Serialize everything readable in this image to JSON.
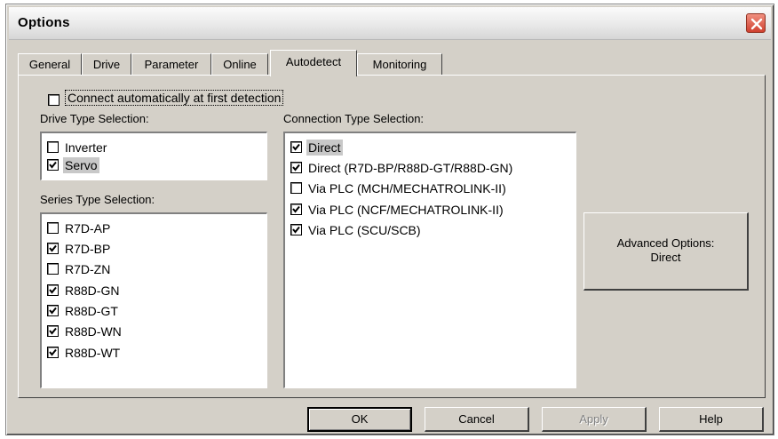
{
  "window": {
    "title": "Options",
    "close_icon": "close-icon"
  },
  "tabs": [
    {
      "label": "General"
    },
    {
      "label": "Drive"
    },
    {
      "label": "Parameter"
    },
    {
      "label": "Online"
    },
    {
      "label": "Autodetect",
      "active": true
    },
    {
      "label": "Monitoring"
    }
  ],
  "autodetect": {
    "connect_auto": {
      "label": "Connect automatically at first detection",
      "checked": false
    },
    "drive_type": {
      "heading": "Drive Type Selection:",
      "items": [
        {
          "label": "Inverter",
          "checked": false
        },
        {
          "label": "Servo",
          "checked": true,
          "selected": true
        }
      ]
    },
    "series_type": {
      "heading": "Series Type Selection:",
      "items": [
        {
          "label": "R7D-AP",
          "checked": false
        },
        {
          "label": "R7D-BP",
          "checked": true
        },
        {
          "label": "R7D-ZN",
          "checked": false
        },
        {
          "label": "R88D-GN",
          "checked": true
        },
        {
          "label": "R88D-GT",
          "checked": true
        },
        {
          "label": "R88D-WN",
          "checked": true
        },
        {
          "label": "R88D-WT",
          "checked": true
        }
      ]
    },
    "connection_type": {
      "heading": "Connection Type Selection:",
      "items": [
        {
          "label": "Direct",
          "checked": true,
          "selected": true
        },
        {
          "label": "Direct (R7D-BP/R88D-GT/R88D-GN)",
          "checked": true
        },
        {
          "label": "Via PLC (MCH/MECHATROLINK-II)",
          "checked": false
        },
        {
          "label": "Via PLC (NCF/MECHATROLINK-II)",
          "checked": true
        },
        {
          "label": "Via PLC (SCU/SCB)",
          "checked": true
        }
      ]
    },
    "advanced_button": {
      "line1": "Advanced Options:",
      "line2": "Direct"
    }
  },
  "buttons": {
    "ok": "OK",
    "cancel": "Cancel",
    "apply": "Apply",
    "help": "Help"
  }
}
